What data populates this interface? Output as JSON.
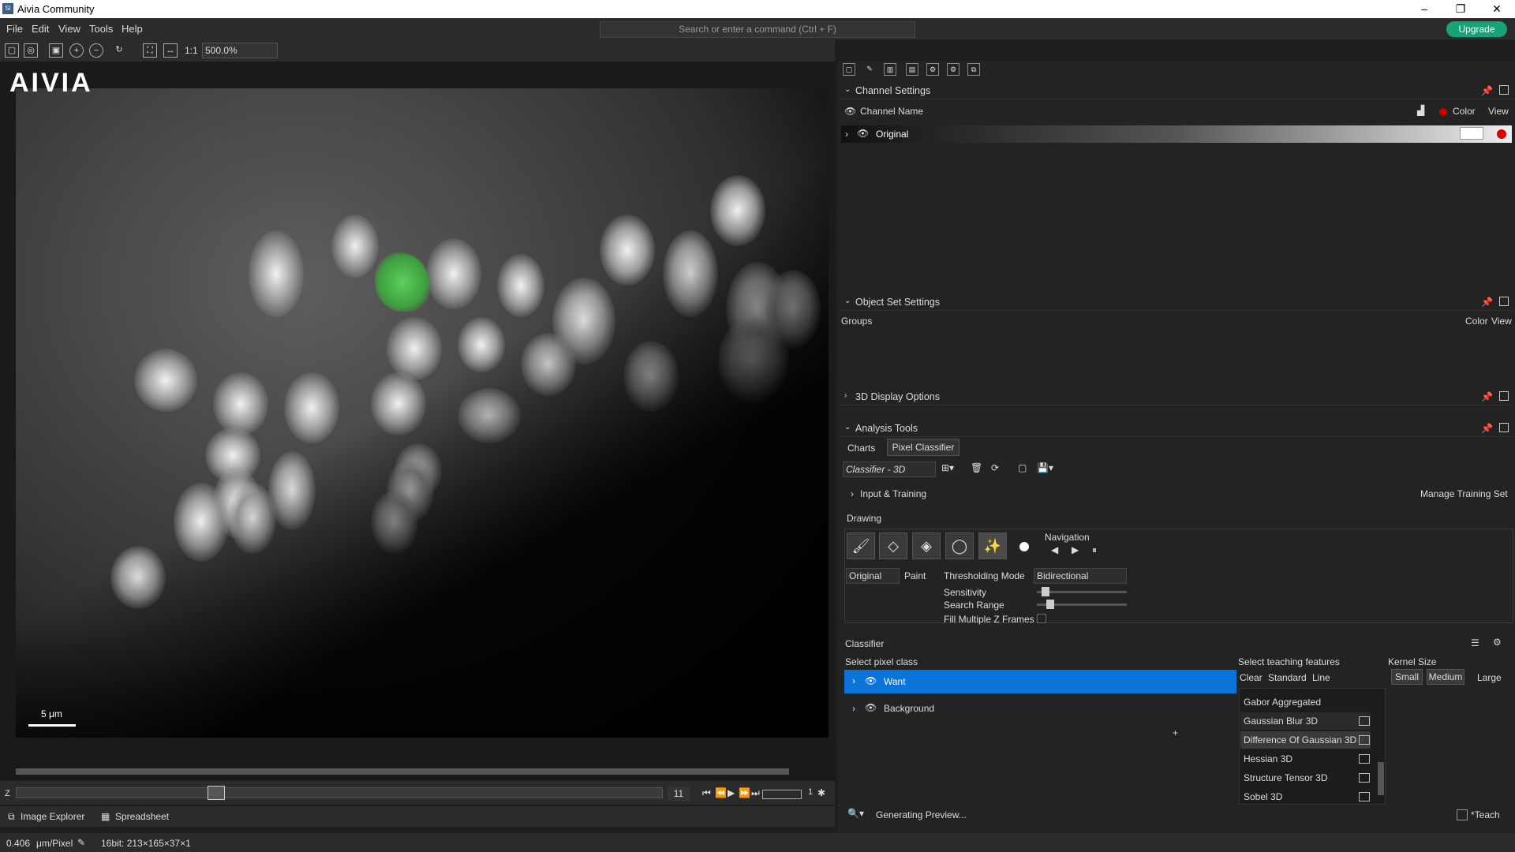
{
  "app": {
    "title": "Aivia Community",
    "logo_text": "AIVIA"
  },
  "menu": [
    "File",
    "Edit",
    "View",
    "Tools",
    "Help"
  ],
  "command": {
    "placeholder": "Search or enter a command (Ctrl + F)"
  },
  "upgrade": "Upgrade",
  "toolbar": {
    "ratio": "1:1",
    "zoom": "500.0%"
  },
  "viewer": {
    "scale": "5 μm"
  },
  "zbar": {
    "label": "Z",
    "frame": "11",
    "zoom": "1"
  },
  "bottom_tabs": [
    "Image Explorer",
    "Spreadsheet"
  ],
  "status": {
    "pixel": "0.406",
    "unit": "μm/Pixel",
    "info": "16bit: 213×165×37×1"
  },
  "channel_settings": {
    "title": "Channel Settings",
    "col_name": "Channel Name",
    "col_color": "Color",
    "col_view": "View",
    "channel": "Original"
  },
  "object_set": {
    "title": "Object Set Settings",
    "groups": "Groups",
    "color": "Color",
    "view": "View"
  },
  "display_3d": {
    "title": "3D Display Options"
  },
  "analysis": {
    "title": "Analysis Tools",
    "tabs": [
      "Charts",
      "Pixel Classifier"
    ],
    "classifier_select": "Classifier - 3D",
    "input_training": "Input & Training",
    "manage": "Manage Training Set",
    "drawing": "Drawing",
    "navigation": "Navigation",
    "source": "Original",
    "paint": "Paint",
    "threshold_label": "Thresholding Mode",
    "threshold_value": "Bidirectional",
    "sensitivity": "Sensitivity",
    "search_range": "Search Range",
    "fill_multiple": "Fill Multiple Z Frames",
    "classifier": "Classifier",
    "select_class": "Select pixel class",
    "classes": [
      "Want",
      "Background"
    ],
    "select_features": "Select teaching features",
    "feature_modes": [
      "Clear",
      "Standard",
      "Line"
    ],
    "kernel_size": "Kernel Size",
    "kernel_opts": [
      "Small",
      "Medium",
      "Large"
    ],
    "features": [
      "Gabor Aggregated",
      "Gaussian Blur 3D",
      "Difference Of Gaussian 3D",
      "Hessian 3D",
      "Structure Tensor 3D",
      "Sobel 3D"
    ],
    "generating": "Generating Preview...",
    "teach": "*Teach"
  }
}
